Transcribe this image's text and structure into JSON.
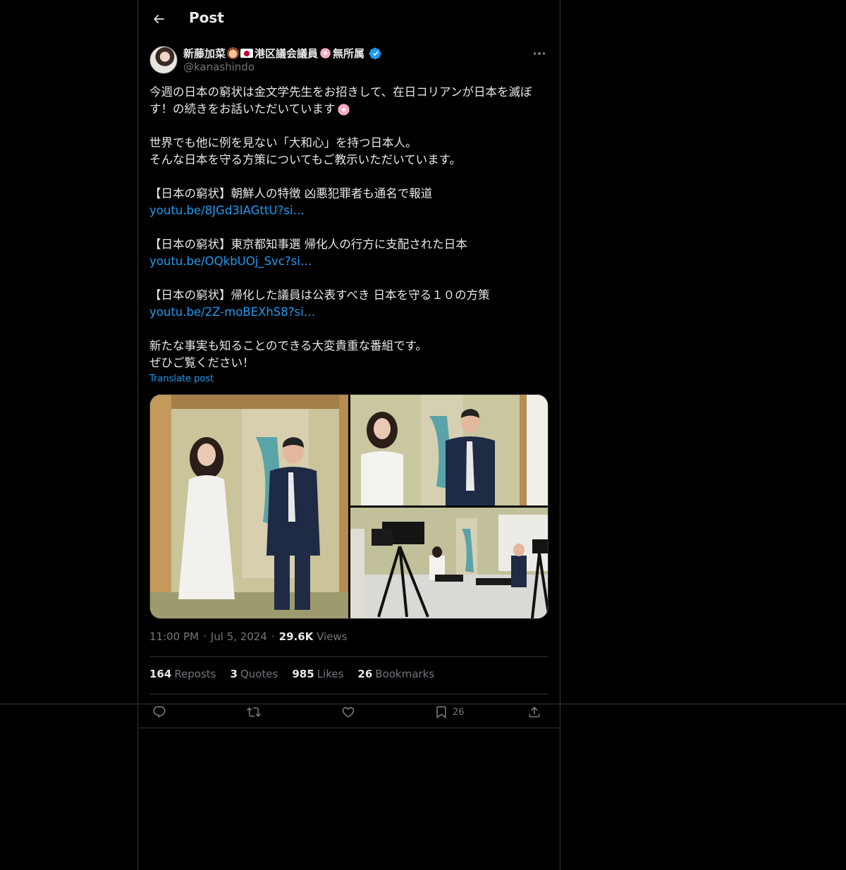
{
  "header": {
    "title": "Post"
  },
  "author": {
    "name_part1": "新藤加菜",
    "name_part2": "港区議会議員",
    "name_part3": "無所属",
    "handle": "@kanashindo"
  },
  "post": {
    "paragraphs": [
      [
        "今週の日本の窮状は金文学先生をお招きして、在日コリアンが日本を滅ぼ",
        "す！の続きをお話いただいています"
      ],
      [
        "世界でも他に例を見ない「大和心」を持つ日本人。",
        "そんな日本を守る方策についてもご教示いただいています。"
      ]
    ],
    "links": [
      {
        "title": "【日本の窮状】朝鮮人の特徴 凶悪犯罪者も通名で報道",
        "url": "youtu.be/8JGd3IAGttU?si…"
      },
      {
        "title": "【日本の窮状】東京都知事選 帰化人の行方に支配された日本",
        "url": "youtu.be/OQkbUOj_Svc?si…"
      },
      {
        "title": "【日本の窮状】帰化した議員は公表すべき 日本を守る１０の方策",
        "url": "youtu.be/2Z-moBEXhS8?si…"
      }
    ],
    "closing": [
      "新たな事実も知ることのできる大変貴重な番組です。",
      "ぜひご覧ください！"
    ],
    "translate_label": "Translate post"
  },
  "meta": {
    "time": "11:00 PM",
    "date": "Jul 5, 2024",
    "views_count": "29.6K",
    "views_label": "Views",
    "separator": "·"
  },
  "stats": {
    "reposts_count": "164",
    "reposts_label": "Reposts",
    "quotes_count": "3",
    "quotes_label": "Quotes",
    "likes_count": "985",
    "likes_label": "Likes",
    "bookmarks_count": "26",
    "bookmarks_label": "Bookmarks"
  },
  "actions": {
    "bookmark_count": "26",
    "icons": [
      "reply-icon",
      "repost-icon",
      "like-icon",
      "bookmark-icon",
      "share-icon"
    ]
  },
  "colors": {
    "link": "#1d9bf0",
    "muted": "#71767b",
    "text": "#e7e9ea",
    "border": "#2f3336"
  }
}
